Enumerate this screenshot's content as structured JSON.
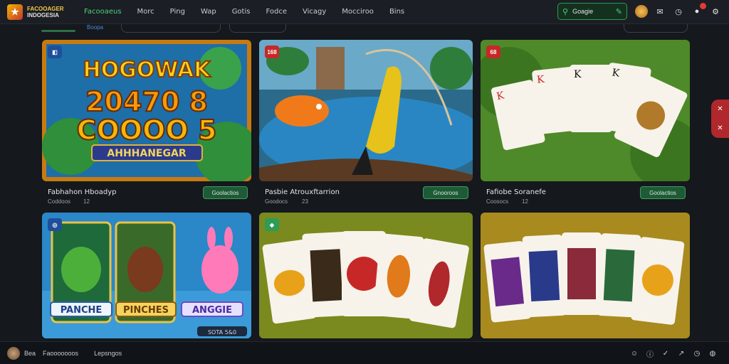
{
  "header": {
    "logo_line1": "FACOOAGER",
    "logo_line2": "INDOGESIA",
    "nav": [
      "Facooaeus",
      "Morc",
      "Ping",
      "Wap",
      "Gotis",
      "Fodce",
      "Vicagy",
      "Mocciroo",
      "Bins"
    ],
    "search_text": "Goagie",
    "notification_count": ""
  },
  "subnav": {
    "label": "Boopa"
  },
  "cards": [
    {
      "badge": "",
      "headline": "HOGOWAK",
      "numbers": "20470 8",
      "numbers2": "COOOO 5",
      "banner": "AHHHANEGAR",
      "title": "Fabhahon Hboadyp",
      "sub": "Coddoos",
      "count": "12",
      "button": "Goolactios"
    },
    {
      "badge": "168",
      "title": "Pasbie Atrouxftarrion",
      "sub": "Goodocs",
      "count": "23",
      "button": "Gnooroos"
    },
    {
      "badge": "68",
      "title": "Fafiobe Soranefe",
      "sub": "Coosocs",
      "count": "12",
      "button": "Goolactios"
    },
    {
      "labels": [
        "PANCHE",
        "PINCHES",
        "ANGGIE"
      ],
      "footer": "SOTA 5&0"
    },
    {
      "badge": ""
    },
    {
      "badge": ""
    }
  ],
  "footer": {
    "left_text": "Bea",
    "item1": "Faooooooos",
    "item2": "Lepsngos"
  },
  "colors": {
    "accent": "#4cd080",
    "danger": "#c62828",
    "bg": "#15181d"
  }
}
